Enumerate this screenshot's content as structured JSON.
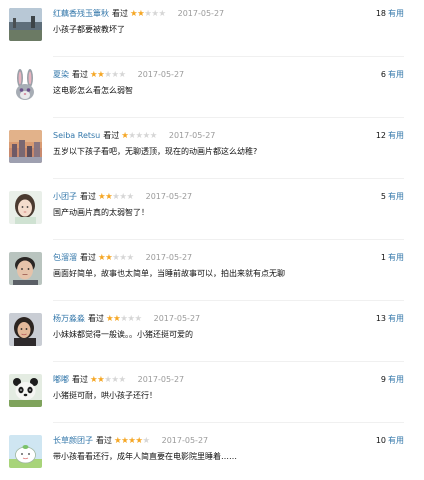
{
  "comments": [
    {
      "user": "红藕香残玉簟秋",
      "watched": "看过",
      "rating": 2,
      "date": "2017-05-27",
      "votes": "18",
      "useful": "有用",
      "text": "小孩子都要被教坏了",
      "avatar": "landscape-avatar"
    },
    {
      "user": "夏染",
      "watched": "看过",
      "rating": 2,
      "date": "2017-05-27",
      "votes": "6",
      "useful": "有用",
      "text": "这电影怎么看怎么弱智",
      "avatar": "bunny-avatar"
    },
    {
      "user": "Seiba Retsu",
      "watched": "看过",
      "rating": 1,
      "date": "2017-05-27",
      "votes": "12",
      "useful": "有用",
      "text": "五岁以下孩子看吧，无聊透顶，现在的动画片都这么幼稚?",
      "avatar": "city-avatar"
    },
    {
      "user": "小团子",
      "watched": "看过",
      "rating": 2,
      "date": "2017-05-27",
      "votes": "5",
      "useful": "有用",
      "text": "国产动画片真的太弱智了！",
      "avatar": "girl-avatar"
    },
    {
      "user": "包溜溜",
      "watched": "看过",
      "rating": 2,
      "date": "2017-05-27",
      "votes": "1",
      "useful": "有用",
      "text": "画面好简单，故事也太简单，当睡前故事可以，拍出来就有点无聊",
      "avatar": "man-avatar"
    },
    {
      "user": "杨万淼淼",
      "watched": "看过",
      "rating": 2,
      "date": "2017-05-27",
      "votes": "13",
      "useful": "有用",
      "text": "小妹妹都觉得一般诶。。小猪还挺可爱的",
      "avatar": "woman-avatar"
    },
    {
      "user": "嘟嘟",
      "watched": "看过",
      "rating": 2,
      "date": "2017-05-27",
      "votes": "9",
      "useful": "有用",
      "text": "小猪挺可耐，哄小孩子还行！",
      "avatar": "panda-avatar"
    },
    {
      "user": "长草颜团子",
      "watched": "看过",
      "rating": 4,
      "date": "2017-05-27",
      "votes": "10",
      "useful": "有用",
      "text": "带小孩看看还行，成年人简直要在电影院里睡着……",
      "avatar": "cartoon-avatar"
    }
  ],
  "colors": {
    "link": "#3377aa",
    "star_on": "#f5a623",
    "star_off": "#d6d6d6",
    "date": "#9a9a9a"
  }
}
